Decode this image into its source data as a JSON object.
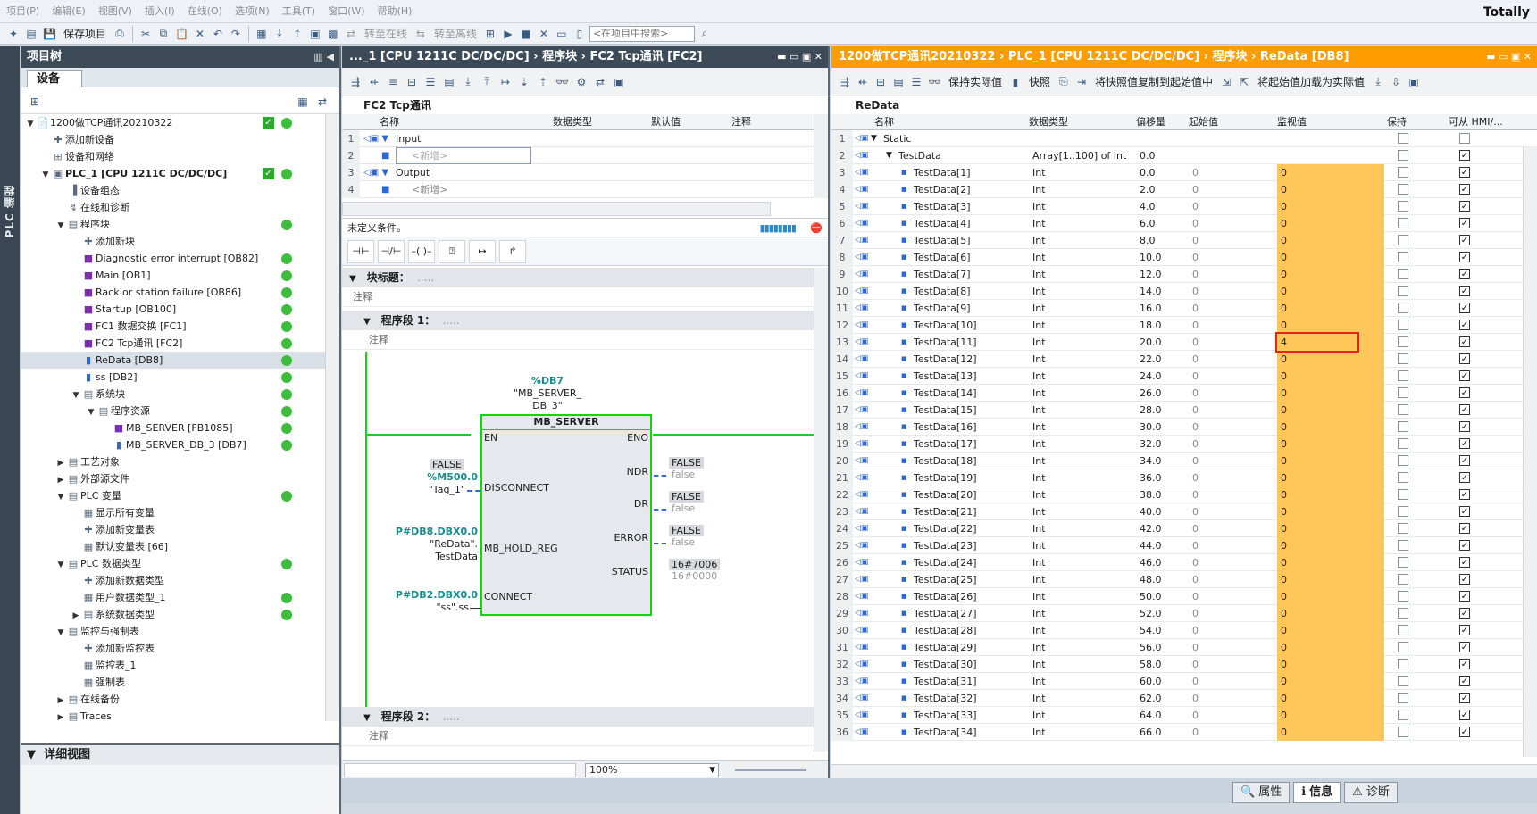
{
  "menu": [
    "项目(P)",
    "编辑(E)",
    "视图(V)",
    "插入(I)",
    "在线(O)",
    "选项(N)",
    "工具(T)",
    "窗口(W)",
    "帮助(H)"
  ],
  "brand": "Totally",
  "toolbar": {
    "save": "保存项目",
    "online": "转至在线",
    "offline": "转至离线",
    "search_placeholder": "<在项目中搜索>"
  },
  "side_tab": "PLC 编程",
  "project_tree": {
    "title": "项目树",
    "devices_tab": "设备",
    "items": [
      {
        "label": "1200做TCP通讯20210322",
        "indent": 0,
        "arrow": "▼",
        "icon": "📄",
        "check": true,
        "status": true
      },
      {
        "label": "添加新设备",
        "indent": 1,
        "arrow": "",
        "icon": "✚"
      },
      {
        "label": "设备和网络",
        "indent": 1,
        "arrow": "",
        "icon": "⊞"
      },
      {
        "label": "PLC_1 [CPU 1211C DC/DC/DC]",
        "indent": 1,
        "arrow": "▼",
        "icon": "▣",
        "check": true,
        "status": true,
        "bold": true
      },
      {
        "label": "设备组态",
        "indent": 2,
        "arrow": "",
        "icon": "▐"
      },
      {
        "label": "在线和诊断",
        "indent": 2,
        "arrow": "",
        "icon": "↯"
      },
      {
        "label": "程序块",
        "indent": 2,
        "arrow": "▼",
        "icon": "▤",
        "status": true
      },
      {
        "label": "添加新块",
        "indent": 3,
        "arrow": "",
        "icon": "✚"
      },
      {
        "label": "Diagnostic error interrupt [OB82]",
        "indent": 3,
        "arrow": "",
        "icon": "■",
        "status": true
      },
      {
        "label": "Main [OB1]",
        "indent": 3,
        "arrow": "",
        "icon": "■",
        "status": true
      },
      {
        "label": "Rack or station failure [OB86]",
        "indent": 3,
        "arrow": "",
        "icon": "■",
        "status": true
      },
      {
        "label": "Startup [OB100]",
        "indent": 3,
        "arrow": "",
        "icon": "■",
        "status": true
      },
      {
        "label": "FC1 数据交换 [FC1]",
        "indent": 3,
        "arrow": "",
        "icon": "■",
        "status": true
      },
      {
        "label": "FC2 Tcp通讯 [FC2]",
        "indent": 3,
        "arrow": "",
        "icon": "■",
        "status": true
      },
      {
        "label": "ReData [DB8]",
        "indent": 3,
        "arrow": "",
        "icon": "▮",
        "status": true,
        "selected": true
      },
      {
        "label": "ss [DB2]",
        "indent": 3,
        "arrow": "",
        "icon": "▮",
        "status": true
      },
      {
        "label": "系统块",
        "indent": 3,
        "arrow": "▼",
        "icon": "▤",
        "status": true
      },
      {
        "label": "程序资源",
        "indent": 4,
        "arrow": "▼",
        "icon": "▤",
        "status": true
      },
      {
        "label": "MB_SERVER [FB1085]",
        "indent": 5,
        "arrow": "",
        "icon": "■",
        "status": true
      },
      {
        "label": "MB_SERVER_DB_3 [DB7]",
        "indent": 5,
        "arrow": "",
        "icon": "▮",
        "status": true
      },
      {
        "label": "工艺对象",
        "indent": 2,
        "arrow": "▶",
        "icon": "▤"
      },
      {
        "label": "外部源文件",
        "indent": 2,
        "arrow": "▶",
        "icon": "▤"
      },
      {
        "label": "PLC 变量",
        "indent": 2,
        "arrow": "▼",
        "icon": "▤",
        "status": true
      },
      {
        "label": "显示所有变量",
        "indent": 3,
        "arrow": "",
        "icon": "▦"
      },
      {
        "label": "添加新变量表",
        "indent": 3,
        "arrow": "",
        "icon": "✚"
      },
      {
        "label": "默认变量表 [66]",
        "indent": 3,
        "arrow": "",
        "icon": "▦"
      },
      {
        "label": "PLC 数据类型",
        "indent": 2,
        "arrow": "▼",
        "icon": "▤",
        "status": true
      },
      {
        "label": "添加新数据类型",
        "indent": 3,
        "arrow": "",
        "icon": "✚"
      },
      {
        "label": "用户数据类型_1",
        "indent": 3,
        "arrow": "",
        "icon": "▦",
        "status": true
      },
      {
        "label": "系统数据类型",
        "indent": 3,
        "arrow": "▶",
        "icon": "▤",
        "status": true
      },
      {
        "label": "监控与强制表",
        "indent": 2,
        "arrow": "▼",
        "icon": "▤"
      },
      {
        "label": "添加新监控表",
        "indent": 3,
        "arrow": "",
        "icon": "✚"
      },
      {
        "label": "监控表_1",
        "indent": 3,
        "arrow": "",
        "icon": "▦"
      },
      {
        "label": "强制表",
        "indent": 3,
        "arrow": "",
        "icon": "▦"
      },
      {
        "label": "在线备份",
        "indent": 2,
        "arrow": "▶",
        "icon": "▤"
      },
      {
        "label": "Traces",
        "indent": 2,
        "arrow": "▶",
        "icon": "▤"
      }
    ],
    "detail_view": "详细视图"
  },
  "editor": {
    "title": "..._1 [CPU 1211C DC/DC/DC]  ›  程序块  ›  FC2 Tcp通讯 [FC2]",
    "block_name": "FC2 Tcp通讯",
    "interface_headers": [
      "名称",
      "数据类型",
      "默认值",
      "注释"
    ],
    "interface_rows": [
      {
        "n": "1",
        "name": "Input",
        "kind": "section"
      },
      {
        "n": "2",
        "name": "<新增>",
        "kind": "add"
      },
      {
        "n": "3",
        "name": "Output",
        "kind": "section"
      },
      {
        "n": "4",
        "name": "<新增>",
        "kind": "add"
      }
    ],
    "condition": "未定义条件。",
    "block_title_label": "块标题：",
    "block_title_dots": ".....",
    "comment": "注释",
    "network1": "程序段 1：",
    "network2": "程序段 2：",
    "dots": ".....",
    "zoom": "100%",
    "fb": {
      "db_addr": "%DB7",
      "db_name1": "\"MB_SERVER_",
      "db_name2": "DB_3\"",
      "name": "MB_SERVER",
      "in_en": "EN",
      "in_disconnect": "DISCONNECT",
      "in_hold": "MB_HOLD_REG",
      "in_connect": "CONNECT",
      "out_eno": "ENO",
      "out_ndr": "NDR",
      "out_dr": "DR",
      "out_error": "ERROR",
      "out_status": "STATUS",
      "disc_val": "FALSE",
      "disc_addr": "%M500.0",
      "disc_tag": "\"Tag_1\"",
      "hold_addr": "P#DB8.DBX0.0",
      "hold_tag1": "\"ReData\".",
      "hold_tag2": "TestData",
      "conn_addr": "P#DB2.DBX0.0",
      "conn_tag": "\"ss\".ss",
      "ndr_val": "FALSE",
      "ndr_sub": "false",
      "dr_val": "FALSE",
      "dr_sub": "false",
      "err_val": "FALSE",
      "err_sub": "false",
      "status_val": "16#7006",
      "status_sub": "16#0000"
    }
  },
  "db": {
    "title": "1200做TCP通讯20210322  ›  PLC_1 [CPU 1211C DC/DC/DC]  ›  程序块  ›  ReData [DB8]",
    "tool_keep": "保持实际值",
    "tool_snapshot": "快照",
    "tool_copy": "将快照值复制到起始值中",
    "tool_load": "将起始值加载为实际值",
    "name": "ReData",
    "headers": {
      "name": "名称",
      "type": "数据类型",
      "offset": "偏移量",
      "start": "起始值",
      "monitor": "监视值",
      "retain": "保持",
      "hmi": "可从 HMI/..."
    },
    "highlight_row": 13,
    "rows": [
      {
        "n": "1",
        "name": "Static",
        "type": "",
        "offset": "",
        "start": "",
        "monitor": "",
        "level": 0,
        "arrow": "▼",
        "retain": false,
        "hmi": false,
        "plainmon": true
      },
      {
        "n": "2",
        "name": "TestData",
        "type": "Array[1..100] of Int",
        "offset": "0.0",
        "start": "",
        "monitor": "",
        "level": 1,
        "arrow": "▼",
        "retain": false,
        "hmi": true,
        "plainmon": true
      },
      {
        "n": "3",
        "name": "TestData[1]",
        "type": "Int",
        "offset": "0.0",
        "start": "0",
        "monitor": "0",
        "level": 2,
        "retain": false,
        "hmi": true
      },
      {
        "n": "4",
        "name": "TestData[2]",
        "type": "Int",
        "offset": "2.0",
        "start": "0",
        "monitor": "0",
        "level": 2,
        "retain": false,
        "hmi": true
      },
      {
        "n": "5",
        "name": "TestData[3]",
        "type": "Int",
        "offset": "4.0",
        "start": "0",
        "monitor": "0",
        "level": 2,
        "retain": false,
        "hmi": true
      },
      {
        "n": "6",
        "name": "TestData[4]",
        "type": "Int",
        "offset": "6.0",
        "start": "0",
        "monitor": "0",
        "level": 2,
        "retain": false,
        "hmi": true
      },
      {
        "n": "7",
        "name": "TestData[5]",
        "type": "Int",
        "offset": "8.0",
        "start": "0",
        "monitor": "0",
        "level": 2,
        "retain": false,
        "hmi": true
      },
      {
        "n": "8",
        "name": "TestData[6]",
        "type": "Int",
        "offset": "10.0",
        "start": "0",
        "monitor": "0",
        "level": 2,
        "retain": false,
        "hmi": true
      },
      {
        "n": "9",
        "name": "TestData[7]",
        "type": "Int",
        "offset": "12.0",
        "start": "0",
        "monitor": "0",
        "level": 2,
        "retain": false,
        "hmi": true
      },
      {
        "n": "10",
        "name": "TestData[8]",
        "type": "Int",
        "offset": "14.0",
        "start": "0",
        "monitor": "0",
        "level": 2,
        "retain": false,
        "hmi": true
      },
      {
        "n": "11",
        "name": "TestData[9]",
        "type": "Int",
        "offset": "16.0",
        "start": "0",
        "monitor": "0",
        "level": 2,
        "retain": false,
        "hmi": true
      },
      {
        "n": "12",
        "name": "TestData[10]",
        "type": "Int",
        "offset": "18.0",
        "start": "0",
        "monitor": "0",
        "level": 2,
        "retain": false,
        "hmi": true
      },
      {
        "n": "13",
        "name": "TestData[11]",
        "type": "Int",
        "offset": "20.0",
        "start": "0",
        "monitor": "4",
        "level": 2,
        "retain": false,
        "hmi": true
      },
      {
        "n": "14",
        "name": "TestData[12]",
        "type": "Int",
        "offset": "22.0",
        "start": "0",
        "monitor": "0",
        "level": 2,
        "retain": false,
        "hmi": true
      },
      {
        "n": "15",
        "name": "TestData[13]",
        "type": "Int",
        "offset": "24.0",
        "start": "0",
        "monitor": "0",
        "level": 2,
        "retain": false,
        "hmi": true
      },
      {
        "n": "16",
        "name": "TestData[14]",
        "type": "Int",
        "offset": "26.0",
        "start": "0",
        "monitor": "0",
        "level": 2,
        "retain": false,
        "hmi": true
      },
      {
        "n": "17",
        "name": "TestData[15]",
        "type": "Int",
        "offset": "28.0",
        "start": "0",
        "monitor": "0",
        "level": 2,
        "retain": false,
        "hmi": true
      },
      {
        "n": "18",
        "name": "TestData[16]",
        "type": "Int",
        "offset": "30.0",
        "start": "0",
        "monitor": "0",
        "level": 2,
        "retain": false,
        "hmi": true
      },
      {
        "n": "19",
        "name": "TestData[17]",
        "type": "Int",
        "offset": "32.0",
        "start": "0",
        "monitor": "0",
        "level": 2,
        "retain": false,
        "hmi": true
      },
      {
        "n": "20",
        "name": "TestData[18]",
        "type": "Int",
        "offset": "34.0",
        "start": "0",
        "monitor": "0",
        "level": 2,
        "retain": false,
        "hmi": true
      },
      {
        "n": "21",
        "name": "TestData[19]",
        "type": "Int",
        "offset": "36.0",
        "start": "0",
        "monitor": "0",
        "level": 2,
        "retain": false,
        "hmi": true
      },
      {
        "n": "22",
        "name": "TestData[20]",
        "type": "Int",
        "offset": "38.0",
        "start": "0",
        "monitor": "0",
        "level": 2,
        "retain": false,
        "hmi": true
      },
      {
        "n": "23",
        "name": "TestData[21]",
        "type": "Int",
        "offset": "40.0",
        "start": "0",
        "monitor": "0",
        "level": 2,
        "retain": false,
        "hmi": true
      },
      {
        "n": "24",
        "name": "TestData[22]",
        "type": "Int",
        "offset": "42.0",
        "start": "0",
        "monitor": "0",
        "level": 2,
        "retain": false,
        "hmi": true
      },
      {
        "n": "25",
        "name": "TestData[23]",
        "type": "Int",
        "offset": "44.0",
        "start": "0",
        "monitor": "0",
        "level": 2,
        "retain": false,
        "hmi": true
      },
      {
        "n": "26",
        "name": "TestData[24]",
        "type": "Int",
        "offset": "46.0",
        "start": "0",
        "monitor": "0",
        "level": 2,
        "retain": false,
        "hmi": true
      },
      {
        "n": "27",
        "name": "TestData[25]",
        "type": "Int",
        "offset": "48.0",
        "start": "0",
        "monitor": "0",
        "level": 2,
        "retain": false,
        "hmi": true
      },
      {
        "n": "28",
        "name": "TestData[26]",
        "type": "Int",
        "offset": "50.0",
        "start": "0",
        "monitor": "0",
        "level": 2,
        "retain": false,
        "hmi": true
      },
      {
        "n": "29",
        "name": "TestData[27]",
        "type": "Int",
        "offset": "52.0",
        "start": "0",
        "monitor": "0",
        "level": 2,
        "retain": false,
        "hmi": true
      },
      {
        "n": "30",
        "name": "TestData[28]",
        "type": "Int",
        "offset": "54.0",
        "start": "0",
        "monitor": "0",
        "level": 2,
        "retain": false,
        "hmi": true
      },
      {
        "n": "31",
        "name": "TestData[29]",
        "type": "Int",
        "offset": "56.0",
        "start": "0",
        "monitor": "0",
        "level": 2,
        "retain": false,
        "hmi": true
      },
      {
        "n": "32",
        "name": "TestData[30]",
        "type": "Int",
        "offset": "58.0",
        "start": "0",
        "monitor": "0",
        "level": 2,
        "retain": false,
        "hmi": true
      },
      {
        "n": "33",
        "name": "TestData[31]",
        "type": "Int",
        "offset": "60.0",
        "start": "0",
        "monitor": "0",
        "level": 2,
        "retain": false,
        "hmi": true
      },
      {
        "n": "34",
        "name": "TestData[32]",
        "type": "Int",
        "offset": "62.0",
        "start": "0",
        "monitor": "0",
        "level": 2,
        "retain": false,
        "hmi": true
      },
      {
        "n": "35",
        "name": "TestData[33]",
        "type": "Int",
        "offset": "64.0",
        "start": "0",
        "monitor": "0",
        "level": 2,
        "retain": false,
        "hmi": true
      },
      {
        "n": "36",
        "name": "TestData[34]",
        "type": "Int",
        "offset": "66.0",
        "start": "0",
        "monitor": "0",
        "level": 2,
        "retain": false,
        "hmi": true
      }
    ]
  },
  "bottom_tabs": [
    {
      "label": "属性",
      "icon": "🔍"
    },
    {
      "label": "信息",
      "icon": "ℹ",
      "active": true
    },
    {
      "label": "诊断",
      "icon": "⚠"
    }
  ],
  "colors": {
    "accent_orange": "#ff9d00",
    "monitor_bg": "#ffc65a",
    "ok_green": "#3cbd3c",
    "fb_green": "#17d117",
    "highlight_red": "#e8231b"
  }
}
